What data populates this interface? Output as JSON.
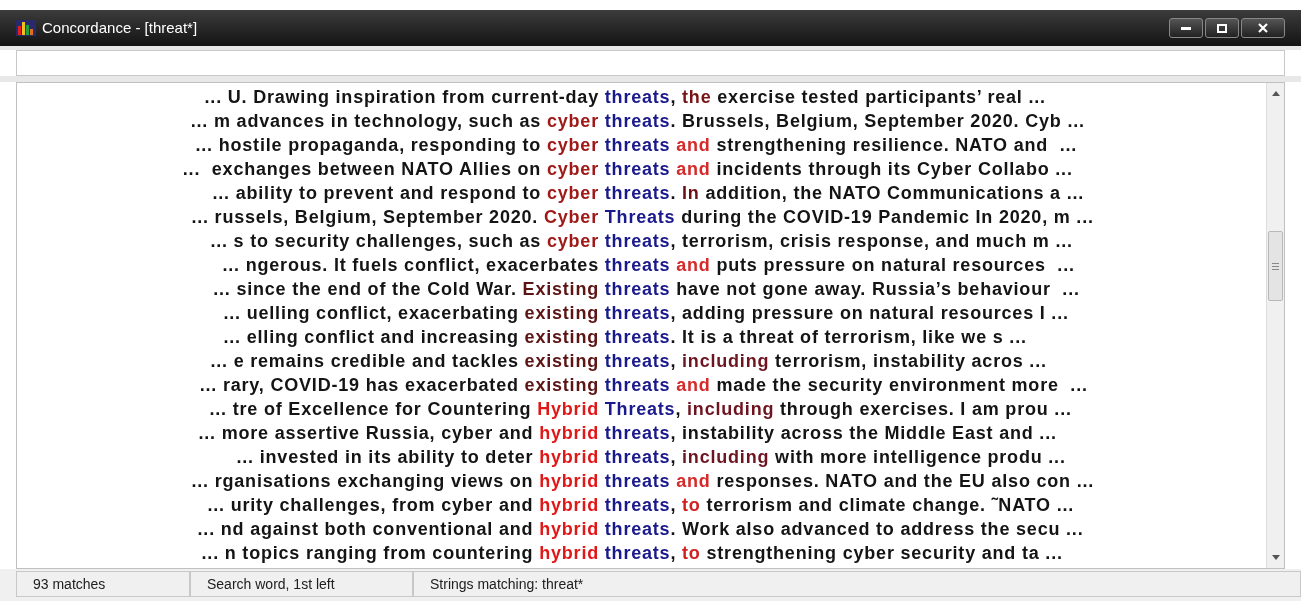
{
  "window": {
    "title": "Concordance - [threat*]"
  },
  "lines": [
    {
      "left": [
        {
          "text": "... U. Drawing inspiration from current-day"
        }
      ],
      "node": "threats",
      "punct": ",",
      "right": [
        {
          "text": "the",
          "color": "#7a1414"
        },
        {
          "text": "exercise tested participants’ real ..."
        }
      ]
    },
    {
      "left": [
        {
          "text": "... m advances in technology, such as"
        },
        {
          "text": "cyber",
          "color": "#a01818"
        }
      ],
      "node": "threats",
      "punct": ".",
      "right": [
        {
          "text": "Brussels, Belgium, September 2020. Cyb ..."
        }
      ]
    },
    {
      "left": [
        {
          "text": "... hostile propaganda, responding to"
        },
        {
          "text": "cyber",
          "color": "#a01818"
        }
      ],
      "node": "threats",
      "right": [
        {
          "text": "and",
          "color": "#d42a2a"
        },
        {
          "text": "strengthening resilience. NATO and  ..."
        }
      ]
    },
    {
      "left": [
        {
          "text": "...  exchanges between NATO Allies on"
        },
        {
          "text": "cyber",
          "color": "#a01818"
        }
      ],
      "node": "threats",
      "right": [
        {
          "text": "and",
          "color": "#d42a2a"
        },
        {
          "text": "incidents through its Cyber Collabo ..."
        }
      ]
    },
    {
      "left": [
        {
          "text": "... ability to prevent and respond to"
        },
        {
          "text": "cyber",
          "color": "#a01818"
        }
      ],
      "node": "threats",
      "punct": ".",
      "right": [
        {
          "text": "In",
          "color": "#6a1010"
        },
        {
          "text": "addition, the NATO Communications a ..."
        }
      ]
    },
    {
      "left": [
        {
          "text": "... russels, Belgium, September 2020."
        },
        {
          "text": "Cyber",
          "color": "#a01818"
        }
      ],
      "node": "Threats",
      "right": [
        {
          "text": "during the COVID-19 Pandemic In 2020, m ..."
        }
      ]
    },
    {
      "left": [
        {
          "text": "... s to security challenges, such as"
        },
        {
          "text": "cyber",
          "color": "#a01818"
        }
      ],
      "node": "threats",
      "punct": ",",
      "right": [
        {
          "text": "terrorism, crisis response, and much m ..."
        }
      ]
    },
    {
      "left": [
        {
          "text": "... ngerous. It fuels conflict, exacerbates"
        }
      ],
      "node": "threats",
      "right": [
        {
          "text": "and",
          "color": "#d42a2a"
        },
        {
          "text": "puts pressure on natural resources  ..."
        }
      ]
    },
    {
      "left": [
        {
          "text": "... since the end of the Cold War."
        },
        {
          "text": "Existing",
          "color": "#5c1414"
        }
      ],
      "node": "threats",
      "right": [
        {
          "text": "have not gone away. Russia’s behaviour  ..."
        }
      ]
    },
    {
      "left": [
        {
          "text": "... uelling conflict, exacerbating"
        },
        {
          "text": "existing",
          "color": "#5c1414"
        }
      ],
      "node": "threats",
      "punct": ",",
      "right": [
        {
          "text": "adding pressure on natural resources I ..."
        }
      ]
    },
    {
      "left": [
        {
          "text": "... elling conflict and increasing"
        },
        {
          "text": "existing",
          "color": "#5c1414"
        }
      ],
      "node": "threats",
      "punct": ".",
      "right": [
        {
          "text": "It is a threat of terrorism, like we s ..."
        }
      ]
    },
    {
      "left": [
        {
          "text": "... e remains credible and tackles"
        },
        {
          "text": "existing",
          "color": "#5c1414"
        }
      ],
      "node": "threats",
      "punct": ",",
      "right": [
        {
          "text": "including",
          "color": "#6e1420"
        },
        {
          "text": "terrorism, instability acros ..."
        }
      ]
    },
    {
      "left": [
        {
          "text": "... rary, COVID-19 has exacerbated"
        },
        {
          "text": "existing",
          "color": "#5c1414"
        }
      ],
      "node": "threats",
      "right": [
        {
          "text": "and",
          "color": "#d42a2a"
        },
        {
          "text": "made the security environment more  ..."
        }
      ]
    },
    {
      "left": [
        {
          "text": "... tre of Excellence for Countering"
        },
        {
          "text": "Hybrid",
          "color": "#e01818"
        }
      ],
      "node": "Threats",
      "punct": ",",
      "right": [
        {
          "text": "including",
          "color": "#6e1420"
        },
        {
          "text": "through exercises. I am prou ..."
        }
      ]
    },
    {
      "left": [
        {
          "text": "... more assertive Russia, cyber and"
        },
        {
          "text": "hybrid",
          "color": "#e01818"
        }
      ],
      "node": "threats",
      "punct": ",",
      "right": [
        {
          "text": "instability across the Middle East and ..."
        }
      ]
    },
    {
      "left": [
        {
          "text": "... invested in its ability to deter"
        },
        {
          "text": "hybrid",
          "color": "#e01818"
        }
      ],
      "node": "threats",
      "punct": ",",
      "right": [
        {
          "text": "including",
          "color": "#6e1420"
        },
        {
          "text": "with more intelligence produ ..."
        }
      ]
    },
    {
      "left": [
        {
          "text": "... rganisations exchanging views on"
        },
        {
          "text": "hybrid",
          "color": "#e01818"
        }
      ],
      "node": "threats",
      "right": [
        {
          "text": "and",
          "color": "#d42a2a"
        },
        {
          "text": "responses. NATO and the EU also con ..."
        }
      ]
    },
    {
      "left": [
        {
          "text": "... urity challenges, from cyber and"
        },
        {
          "text": "hybrid",
          "color": "#e01818"
        }
      ],
      "node": "threats",
      "punct": ",",
      "right": [
        {
          "text": "to",
          "color": "#d02020"
        },
        {
          "text": "terrorism and climate change. ˜NATO ..."
        }
      ]
    },
    {
      "left": [
        {
          "text": "... nd against both conventional and"
        },
        {
          "text": "hybrid",
          "color": "#e01818"
        }
      ],
      "node": "threats",
      "punct": ".",
      "right": [
        {
          "text": "Work also advanced to address the secu ..."
        }
      ]
    },
    {
      "left": [
        {
          "text": "... n topics ranging from countering"
        },
        {
          "text": "hybrid",
          "color": "#e01818"
        }
      ],
      "node": "threats",
      "punct": ",",
      "right": [
        {
          "text": "to",
          "color": "#d02020"
        },
        {
          "text": "strengthening cyber security and ta ..."
        }
      ]
    }
  ],
  "status_bar": [
    "93 matches",
    "Search word, 1st left",
    "Strings matching: threat*"
  ]
}
